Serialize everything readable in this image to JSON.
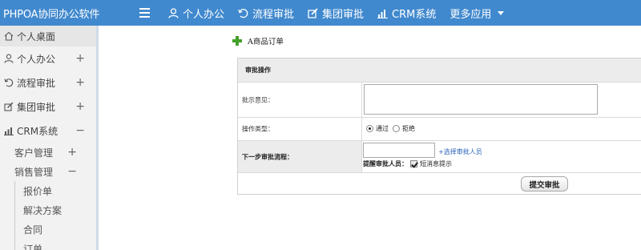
{
  "app": {
    "title": "PHPOA协同办公软件"
  },
  "topnav": {
    "items": [
      {
        "label": "个人办公",
        "icon": "user-icon"
      },
      {
        "label": "流程审批",
        "icon": "workflow-icon"
      },
      {
        "label": "集团审批",
        "icon": "edit-icon"
      },
      {
        "label": "CRM系统",
        "icon": "bar-chart-icon"
      },
      {
        "label": "更多应用",
        "icon": "caret-down-icon"
      }
    ]
  },
  "sidebar": {
    "items": [
      {
        "label": "个人桌面",
        "icon": "home-icon",
        "toggle": ""
      },
      {
        "label": "个人办公",
        "icon": "user-icon",
        "toggle": "+"
      },
      {
        "label": "流程审批",
        "icon": "workflow-icon",
        "toggle": "+"
      },
      {
        "label": "集团审批",
        "icon": "edit-icon",
        "toggle": "+"
      },
      {
        "label": "CRM系统",
        "icon": "bar-chart-icon",
        "toggle": "−"
      }
    ],
    "crm_sub": [
      {
        "label": "客户管理",
        "toggle": "+"
      },
      {
        "label": "销售管理",
        "toggle": "−"
      }
    ],
    "sales_leaves": [
      "报价单",
      "解决方案",
      "合同",
      "订单"
    ]
  },
  "page": {
    "title": "A商品订单"
  },
  "form": {
    "section_title": "审批操作",
    "opinion_label": "批示意见：",
    "opinion_value": "",
    "type_label": "操作类型：",
    "type_options": [
      {
        "label": "通过",
        "checked": true
      },
      {
        "label": "拒绝",
        "checked": false
      }
    ],
    "next_label": "下一步审批流程：",
    "next_value": "",
    "select_link": "+选择审批人员",
    "remind_label": "提醒审批人员：",
    "remind_option": "短消息提示",
    "remind_checked": true,
    "submit_label": "提交审批"
  },
  "colors": {
    "topbar": "#4189ce",
    "sidebar_bg": "#f2f2f2",
    "link": "#2a62b9",
    "plus_icon": "#43a02a"
  }
}
